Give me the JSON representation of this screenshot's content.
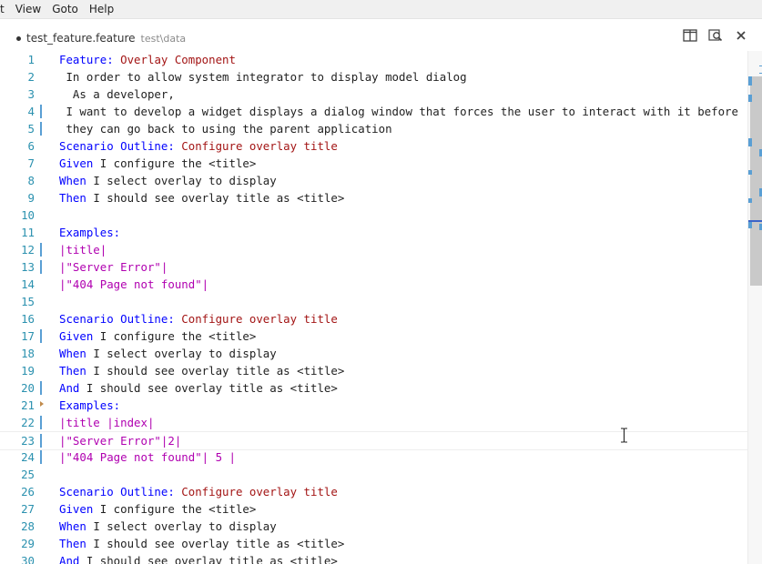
{
  "menu": [
    "t",
    "View",
    "Goto",
    "Help"
  ],
  "tab": {
    "title": "test_feature.feature",
    "path": "test\\data"
  },
  "toolbar_icons": [
    "split-editor-icon",
    "open-preview-icon",
    "close-icon"
  ],
  "colors": {
    "keyword": "#0000ff",
    "title": "#a31515",
    "table": "#b000b0",
    "line_number": "#2b91af",
    "gutter_mark": "#5a9fd4"
  },
  "lines": [
    {
      "n": "1",
      "tokens": [
        {
          "t": "Feature: ",
          "c": "kw"
        },
        {
          "t": "Overlay Component",
          "c": "tt"
        }
      ]
    },
    {
      "n": "2",
      "tokens": [
        {
          "t": " In order to allow system integrator to display model dialog",
          "c": "tx"
        }
      ]
    },
    {
      "n": "3",
      "tokens": [
        {
          "t": "  As a developer,",
          "c": "tx"
        }
      ]
    },
    {
      "n": "4",
      "mark": true,
      "tokens": [
        {
          "t": " I want to develop a widget displays a dialog window that forces the user to interact with it before",
          "c": "tx"
        }
      ]
    },
    {
      "n": "5",
      "mark": true,
      "tokens": [
        {
          "t": " they can go back to using the parent application",
          "c": "tx"
        }
      ]
    },
    {
      "n": "6",
      "tokens": [
        {
          "t": "Scenario Outline: ",
          "c": "kw"
        },
        {
          "t": "Configure overlay title",
          "c": "tt"
        }
      ]
    },
    {
      "n": "7",
      "tokens": [
        {
          "t": "Given ",
          "c": "kw"
        },
        {
          "t": "I configure the <title>",
          "c": "tx"
        }
      ]
    },
    {
      "n": "8",
      "tokens": [
        {
          "t": "When ",
          "c": "kw"
        },
        {
          "t": "I select overlay to display",
          "c": "tx"
        }
      ]
    },
    {
      "n": "9",
      "tokens": [
        {
          "t": "Then ",
          "c": "kw"
        },
        {
          "t": "I should see overlay title as <title>",
          "c": "tx"
        }
      ]
    },
    {
      "n": "10",
      "tokens": []
    },
    {
      "n": "11",
      "tokens": [
        {
          "t": "Examples:",
          "c": "kw"
        }
      ]
    },
    {
      "n": "12",
      "mark": true,
      "tokens": [
        {
          "t": "|title|",
          "c": "tb"
        }
      ]
    },
    {
      "n": "13",
      "mark": true,
      "tokens": [
        {
          "t": "|\"Server Error\"|",
          "c": "tb"
        }
      ]
    },
    {
      "n": "14",
      "tokens": [
        {
          "t": "|\"404 Page not found\"|",
          "c": "tb"
        }
      ]
    },
    {
      "n": "15",
      "tokens": []
    },
    {
      "n": "16",
      "tokens": [
        {
          "t": "Scenario Outline: ",
          "c": "kw"
        },
        {
          "t": "Configure overlay title",
          "c": "tt"
        }
      ]
    },
    {
      "n": "17",
      "mark": true,
      "tokens": [
        {
          "t": "Given ",
          "c": "kw"
        },
        {
          "t": "I configure the <title>",
          "c": "tx"
        }
      ]
    },
    {
      "n": "18",
      "tokens": [
        {
          "t": "When ",
          "c": "kw"
        },
        {
          "t": "I select overlay to display",
          "c": "tx"
        }
      ]
    },
    {
      "n": "19",
      "tokens": [
        {
          "t": "Then ",
          "c": "kw"
        },
        {
          "t": "I should see overlay title as <title>",
          "c": "tx"
        }
      ]
    },
    {
      "n": "20",
      "mark": true,
      "tokens": [
        {
          "t": "And ",
          "c": "kw"
        },
        {
          "t": "I should see overlay title as <title>",
          "c": "tx"
        }
      ]
    },
    {
      "n": "21",
      "fold": true,
      "tokens": [
        {
          "t": "Examples:",
          "c": "kw"
        }
      ]
    },
    {
      "n": "22",
      "mark": true,
      "tokens": [
        {
          "t": "|title |index|",
          "c": "tb"
        }
      ]
    },
    {
      "n": "23",
      "mark": true,
      "current": true,
      "tokens": [
        {
          "t": "|\"Server Error\"|2|",
          "c": "tb"
        }
      ]
    },
    {
      "n": "24",
      "mark": true,
      "tokens": [
        {
          "t": "|\"404 Page not found\"| 5 |",
          "c": "tb"
        }
      ]
    },
    {
      "n": "25",
      "tokens": []
    },
    {
      "n": "26",
      "tokens": [
        {
          "t": "Scenario Outline: ",
          "c": "kw"
        },
        {
          "t": "Configure overlay title",
          "c": "tt"
        }
      ]
    },
    {
      "n": "27",
      "tokens": [
        {
          "t": "Given ",
          "c": "kw"
        },
        {
          "t": "I configure the <title>",
          "c": "tx"
        }
      ]
    },
    {
      "n": "28",
      "tokens": [
        {
          "t": "When ",
          "c": "kw"
        },
        {
          "t": "I select overlay to display",
          "c": "tx"
        }
      ]
    },
    {
      "n": "29",
      "tokens": [
        {
          "t": "Then ",
          "c": "kw"
        },
        {
          "t": "I should see overlay title as <title>",
          "c": "tx"
        }
      ]
    },
    {
      "n": "30",
      "tokens": [
        {
          "t": "And ",
          "c": "kw"
        },
        {
          "t": "I should see overlay title as <title>",
          "c": "tx"
        }
      ]
    }
  ]
}
